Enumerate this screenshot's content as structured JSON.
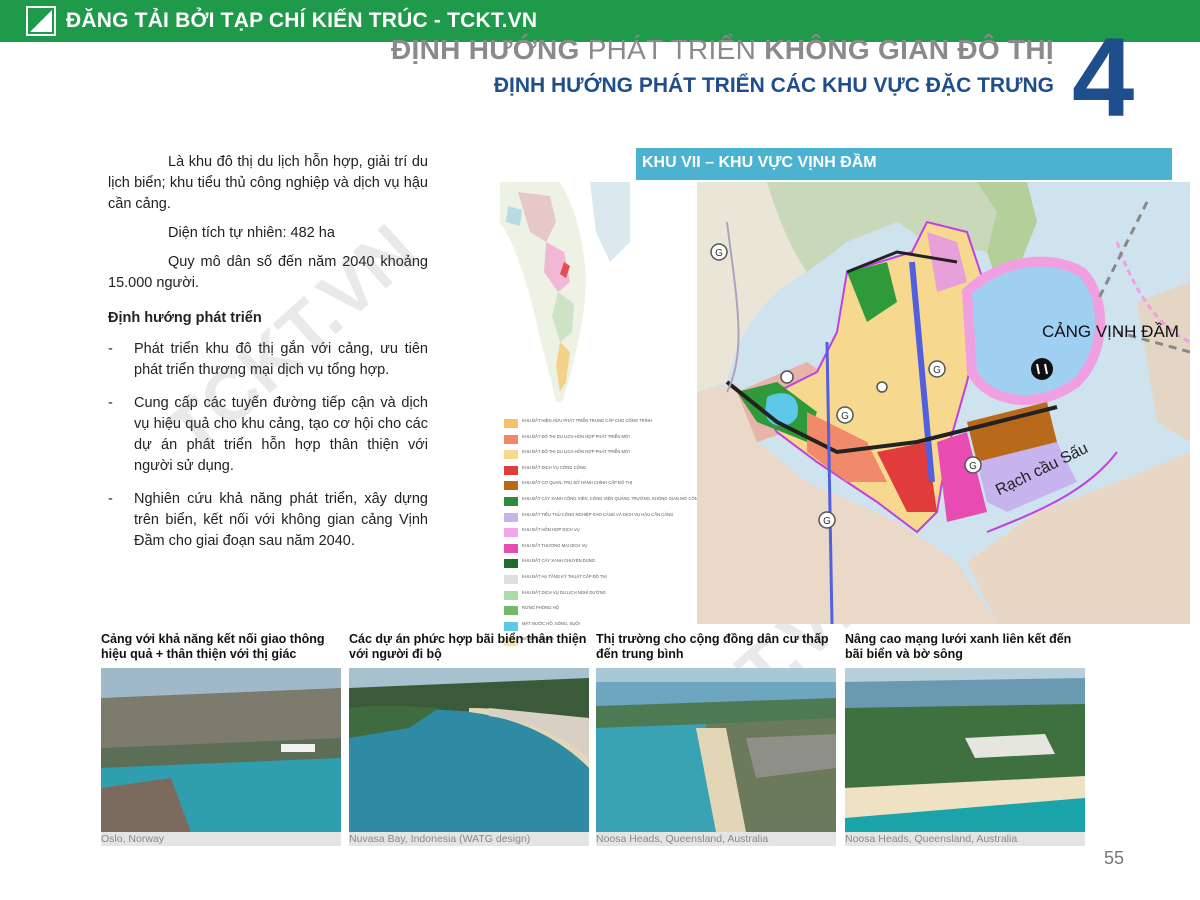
{
  "banner": {
    "logo_icon": "triangle-logo-icon",
    "text": "ĐĂNG TẢI BỞI TẠP CHÍ KIẾN TRÚC - TCKT.VN"
  },
  "header": {
    "title_part1": "ĐỊNH HƯỚNG",
    "title_part2": "PHÁT TRIỂN",
    "title_part3": "KHÔNG GIAN ĐÔ THỊ",
    "subtitle": "ĐỊNH HƯỚNG PHÁT TRIỂN CÁC KHU VỰC ĐẶC TRƯNG",
    "chapter_number": "4"
  },
  "intro": {
    "paragraph": "Là khu đô thị du lịch hỗn hợp, giải trí du lịch biển; khu tiểu thủ công nghiệp và dịch vụ hậu cần cảng.",
    "area": "Diện tích tự nhiên: 482 ha",
    "population": "Quy mô dân số đến năm 2040 khoảng 15.000 người."
  },
  "orientation": {
    "heading": "Định hướng phát triển",
    "bullet_char": "-",
    "items": [
      "Phát triển khu đô thị gắn với cảng, ưu tiên phát triển thương mại dịch vụ tổng hợp.",
      "Cung cấp các tuyến đường tiếp cận và dịch vụ hiệu quả cho khu cảng, tạo cơ hội cho các dự án phát triển hỗn hợp thân thiện với người sử dụng.",
      "Nghiên cứu khả năng phát triển, xây dựng trên biển, kết nối với không gian cảng Vịnh Đầm cho giai đoạn sau năm 2040."
    ]
  },
  "watermark": {
    "text": "TCKT.VN"
  },
  "section": {
    "title": "KHU VII – KHU VỰC VỊNH ĐẦM"
  },
  "map": {
    "port_label": "CẢNG VỊNH ĐẦM",
    "river_label": "Rạch cầu Sấu",
    "road_marker": "G",
    "colors": {
      "sea": "#cfe3ee",
      "residential": "#f6d98f",
      "mixed_use": "#f08a6a",
      "commercial": "#e8a0d8",
      "industrial": "#b86a1a",
      "green": "#2e9a3a",
      "port_water": "#9fd0f2",
      "port_land": "#f0a0e0",
      "boundary": "#c040e0",
      "road": "#5060e0"
    }
  },
  "legend": {
    "items": [
      {
        "color": "#f6c06a",
        "label": "Khu đất hiện hữu phát triển trung cấp cho công trình"
      },
      {
        "color": "#f0866a",
        "label": "Khu đất đô thị du lịch hỗn hợp phát triển mới"
      },
      {
        "color": "#f6d98f",
        "label": "Khu đất đô thị du lịch hỗn hợp phát triển mới"
      },
      {
        "color": "#e23b3b",
        "label": "Khu đất dịch vụ công cộng"
      },
      {
        "color": "#b86a1a",
        "label": "Khu đất cơ quan, trụ sở hành chính cấp đô thị"
      },
      {
        "color": "#2e8b3a",
        "label": "Khu đất cây xanh công viên, công viên quảng trường, không gian mở công cộng"
      },
      {
        "color": "#c7b3ee",
        "label": "Khu đất tiểu thủ công nghiệp kho cảng và dịch vụ hậu cần cảng"
      },
      {
        "color": "#f2a7e8",
        "label": "Khu đất hỗn hợp dịch vụ"
      },
      {
        "color": "#e84bb2",
        "label": "Khu đất thương mại dịch vụ"
      },
      {
        "color": "#1f6b2b",
        "label": "Khu đất cây xanh chuyên dùng"
      },
      {
        "color": "#dedede",
        "label": "Khu đất hạ tầng kỹ thuật cấp đô thị"
      },
      {
        "color": "#a8dca8",
        "label": "Khu đất dịch vụ du lịch nghỉ dưỡng"
      },
      {
        "color": "#74b86a",
        "label": "Rừng phòng hộ"
      },
      {
        "color": "#5ec8e8",
        "label": "Mặt nước hồ, sông, suối"
      },
      {
        "color": "#f4e6b0",
        "label": "Bãi cát, bãi đá"
      }
    ]
  },
  "photos": [
    {
      "title": "Cảng với khả năng kết nối giao thông hiệu quả + thân thiện với thị giác",
      "caption": "Oslo, Norway"
    },
    {
      "title": "Các dự án phức hợp bãi biển thân thiện với người đi bộ",
      "caption": "Nuvasa Bay, Indonesia (WATG design)"
    },
    {
      "title": "Thị trường cho cộng đồng dân cư thấp đến trung bình",
      "caption": "Noosa Heads, Queensland, Australia"
    },
    {
      "title": "Nâng cao mạng lưới xanh liên kết đến bãi biển và bờ sông",
      "caption": "Noosa Heads, Queensland, Australia"
    }
  ],
  "page": {
    "number": "55"
  }
}
